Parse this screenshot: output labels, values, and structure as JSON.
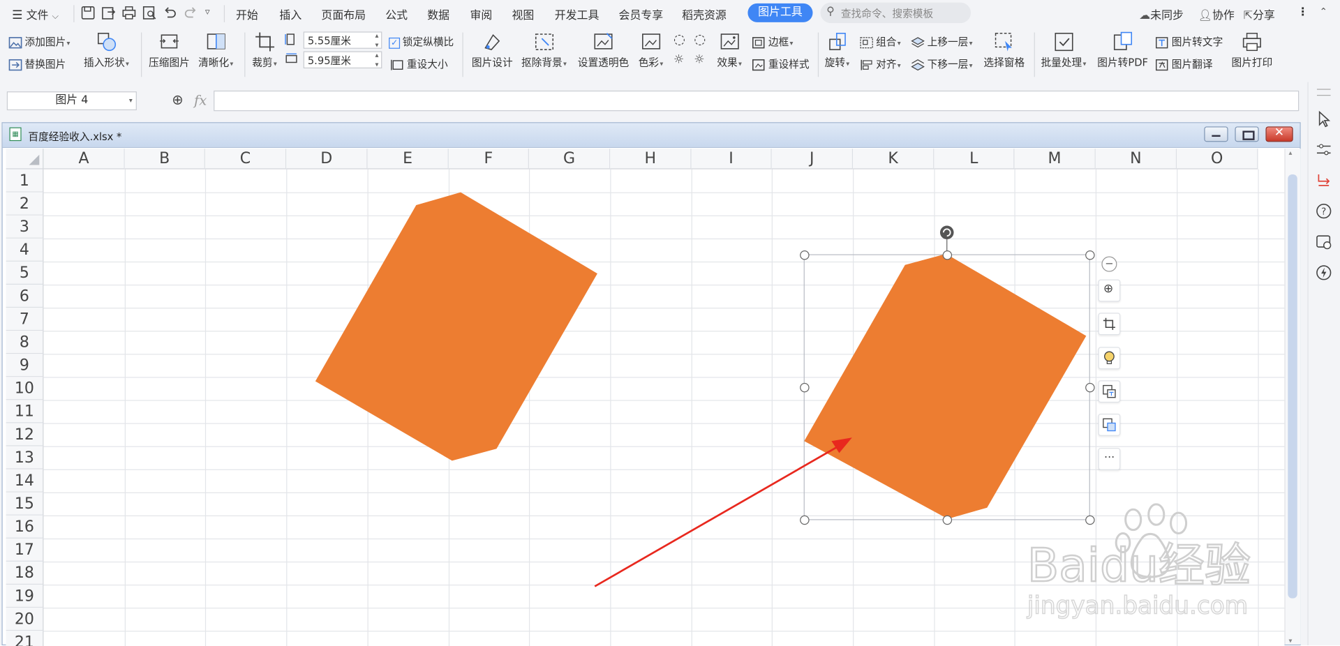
{
  "menubar": {
    "file_label": "文件",
    "tabs": [
      "开始",
      "插入",
      "页面布局",
      "公式",
      "数据",
      "审阅",
      "视图",
      "开发工具",
      "会员专享",
      "稻壳资源"
    ],
    "active_tab": "图片工具",
    "search_placeholder": "查找命令、搜索模板",
    "right": [
      "未同步",
      "协作",
      "分享"
    ]
  },
  "ribbon": {
    "add_picture": "添加图片",
    "replace_picture": "替换图片",
    "insert_shape": "插入形状",
    "compress_picture": "压缩图片",
    "sharpen": "清晰化",
    "crop": "裁剪",
    "height_value": "5.55厘米",
    "width_value": "5.95厘米",
    "lock_ratio": "锁定纵横比",
    "reset_size": "重设大小",
    "picture_design": "图片设计",
    "remove_background": "抠除背景",
    "set_transparent": "设置透明色",
    "color": "色彩",
    "effects": "效果",
    "border": "边框",
    "reset_style": "重设样式",
    "rotate": "旋转",
    "group": "组合",
    "align": "对齐",
    "bring_forward": "上移一层",
    "send_backward": "下移一层",
    "selection_pane": "选择窗格",
    "batch": "批量处理",
    "to_pdf": "图片转PDF",
    "to_text": "图片转文字",
    "translate": "图片翻译",
    "print": "图片打印"
  },
  "formula": {
    "name_box": "图片 4",
    "fx": "fx",
    "value": ""
  },
  "workbook": {
    "title": "百度经验收入.xlsx *",
    "columns": [
      "A",
      "B",
      "C",
      "D",
      "E",
      "F",
      "G",
      "H",
      "I",
      "J",
      "K",
      "L",
      "M",
      "N",
      "O"
    ],
    "rows": [
      "1",
      "2",
      "3",
      "4",
      "5",
      "6",
      "7",
      "8",
      "9",
      "10",
      "11",
      "12",
      "13",
      "14",
      "15",
      "16",
      "17",
      "18",
      "19",
      "20",
      "21"
    ]
  },
  "colors": {
    "shape_fill": "#ED7D31",
    "arrow": "#E8281E",
    "accent": "#3F86F5"
  },
  "watermark": {
    "brand": "Baidu经验",
    "url": "jingyan.baidu.com"
  }
}
